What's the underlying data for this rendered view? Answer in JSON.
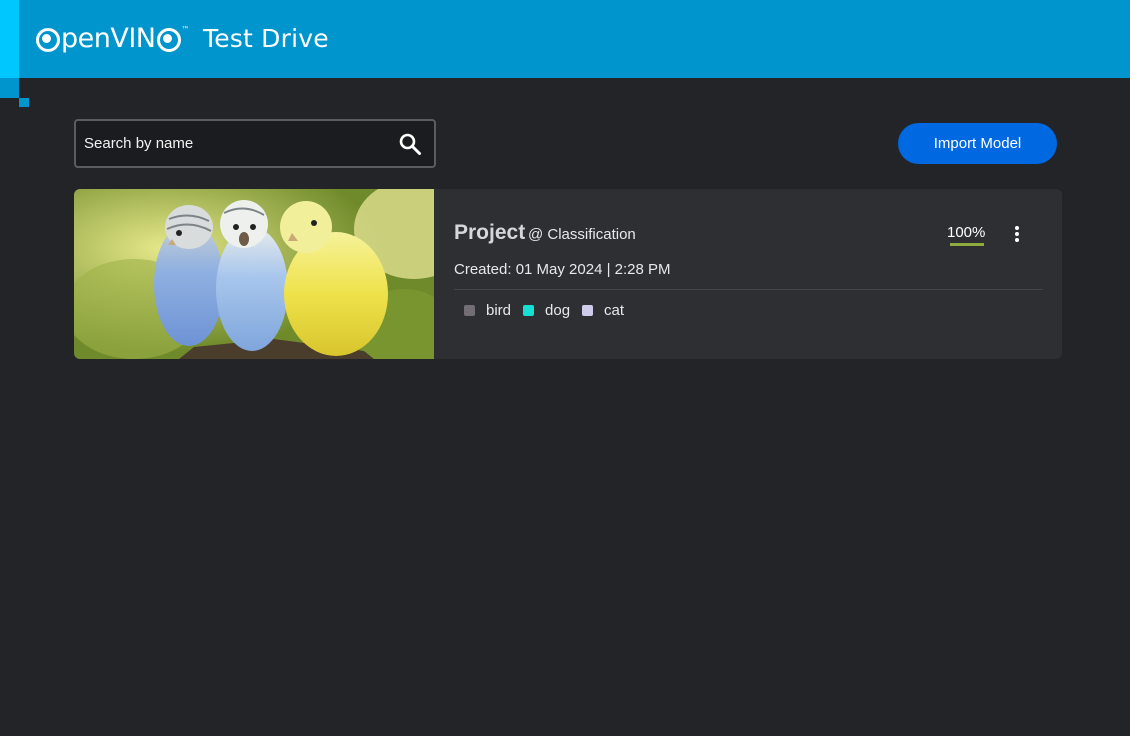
{
  "header": {
    "logo_text": "penVIN",
    "logo_tm": "™",
    "app_title": "Test Drive"
  },
  "search": {
    "placeholder": "Search by name",
    "value": ""
  },
  "toolbar": {
    "import_label": "Import Model"
  },
  "project": {
    "name": "Project",
    "task": "@ Classification",
    "created": "Created: 01 May 2024 | 2:28 PM",
    "progress_text": "100%",
    "progress": 1.0,
    "labels": [
      {
        "name": "bird",
        "color": "#736d76"
      },
      {
        "name": "dog",
        "color": "#16e0d3"
      },
      {
        "name": "cat",
        "color": "#d0cbea"
      }
    ]
  },
  "colors": {
    "header": "#0095cd",
    "accent": "#00c7fd",
    "primary_button": "#0068e0",
    "background": "#232428",
    "card": "#2e2f33",
    "progress": "#8faa3e"
  }
}
